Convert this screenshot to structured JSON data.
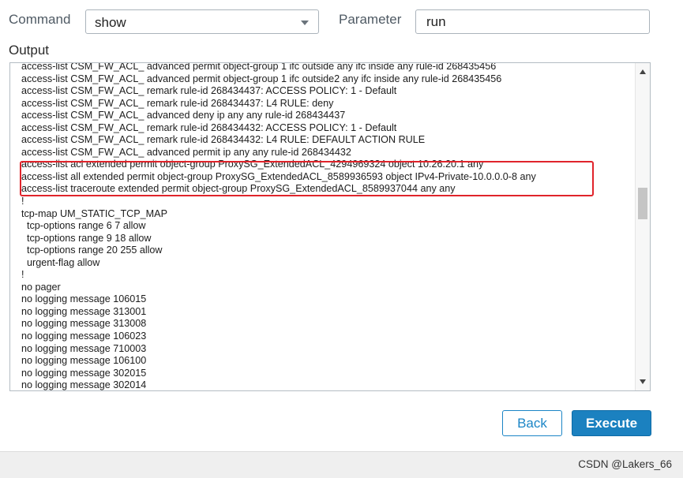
{
  "form": {
    "command_label": "Command",
    "command_value": "show",
    "parameter_label": "Parameter",
    "parameter_value": "run",
    "output_label": "Output"
  },
  "output": {
    "lines": [
      "access-list CSM_FW_ACL_ advanced permit object-group 1 ifc outside any ifc inside any rule-id 268435456",
      "access-list CSM_FW_ACL_ advanced permit object-group 1 ifc outside2 any ifc inside any rule-id 268435456",
      "access-list CSM_FW_ACL_ remark rule-id 268434437: ACCESS POLICY: 1 - Default",
      "access-list CSM_FW_ACL_ remark rule-id 268434437: L4 RULE: deny",
      "access-list CSM_FW_ACL_ advanced deny ip any any rule-id 268434437",
      "access-list CSM_FW_ACL_ remark rule-id 268434432: ACCESS POLICY: 1 - Default",
      "access-list CSM_FW_ACL_ remark rule-id 268434432: L4 RULE: DEFAULT ACTION RULE",
      "access-list CSM_FW_ACL_ advanced permit ip any any rule-id 268434432",
      "access-list acl extended permit object-group ProxySG_ExtendedACL_4294969324 object 10.26.20.1 any",
      "access-list all extended permit object-group ProxySG_ExtendedACL_8589936593 object IPv4-Private-10.0.0.0-8 any",
      "access-list traceroute extended permit object-group ProxySG_ExtendedACL_8589937044 any any",
      "!",
      "tcp-map UM_STATIC_TCP_MAP",
      "  tcp-options range 6 7 allow",
      "  tcp-options range 9 18 allow",
      "  tcp-options range 20 255 allow",
      "  urgent-flag allow",
      "!",
      "no pager",
      "no logging message 106015",
      "no logging message 313001",
      "no logging message 313008",
      "no logging message 106023",
      "no logging message 710003",
      "no logging message 106100",
      "no logging message 302015",
      "no logging message 302014"
    ]
  },
  "buttons": {
    "back": "Back",
    "execute": "Execute"
  },
  "footer": {
    "watermark": "CSDN @Lakers_66"
  },
  "colors": {
    "accent": "#1b81c0",
    "highlight_border": "#e0242b"
  }
}
